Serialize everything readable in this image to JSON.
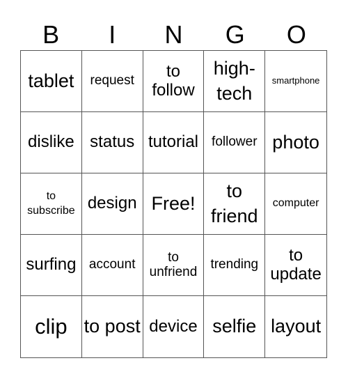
{
  "header": {
    "letters": [
      "B",
      "I",
      "N",
      "G",
      "O"
    ]
  },
  "cells": [
    {
      "text": "tablet",
      "size": "s-l"
    },
    {
      "text": "request",
      "size": "s-s"
    },
    {
      "text": "to follow",
      "size": "s-m"
    },
    {
      "text": "high-tech",
      "size": "s-l"
    },
    {
      "text": "smartphone",
      "size": "s-xxs"
    },
    {
      "text": "dislike",
      "size": "s-m"
    },
    {
      "text": "status",
      "size": "s-m"
    },
    {
      "text": "tutorial",
      "size": "s-m"
    },
    {
      "text": "follower",
      "size": "s-s"
    },
    {
      "text": "photo",
      "size": "s-l"
    },
    {
      "text": "to subscribe",
      "size": "s-xs"
    },
    {
      "text": "design",
      "size": "s-m"
    },
    {
      "text": "Free!",
      "size": "s-l"
    },
    {
      "text": "to friend",
      "size": "s-l"
    },
    {
      "text": "computer",
      "size": "s-xs"
    },
    {
      "text": "surfing",
      "size": "s-m"
    },
    {
      "text": "account",
      "size": "s-s"
    },
    {
      "text": "to unfriend",
      "size": "s-s"
    },
    {
      "text": "trending",
      "size": "s-s"
    },
    {
      "text": "to update",
      "size": "s-m"
    },
    {
      "text": "clip",
      "size": "s-xl"
    },
    {
      "text": "to post",
      "size": "s-l"
    },
    {
      "text": "device",
      "size": "s-m"
    },
    {
      "text": "selfie",
      "size": "s-l"
    },
    {
      "text": "layout",
      "size": "s-l"
    }
  ]
}
